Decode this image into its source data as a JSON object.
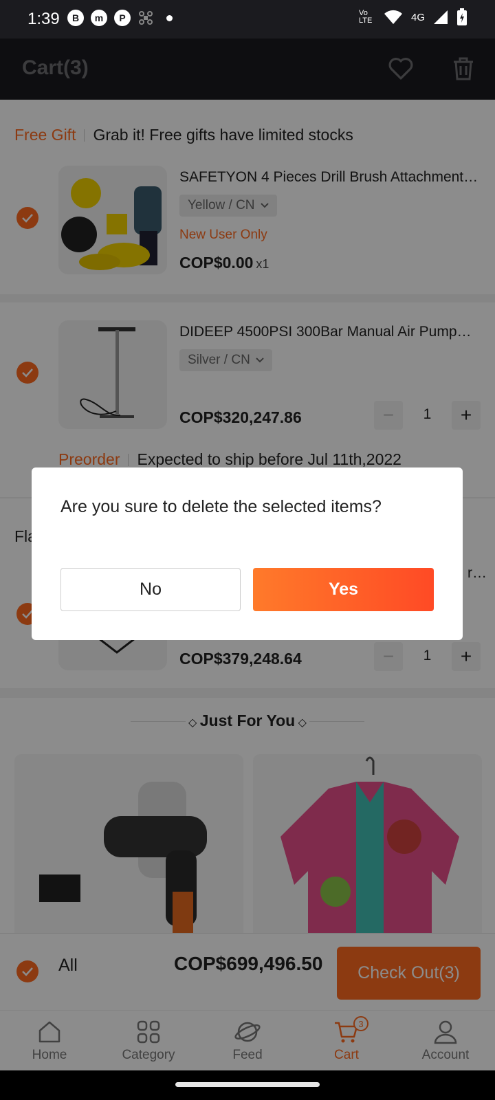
{
  "status_bar": {
    "time": "1:39",
    "notif_icons": [
      "B",
      "m",
      "P"
    ],
    "network": "4G",
    "volte": "Vo LTE"
  },
  "header": {
    "title": "Cart(3)"
  },
  "free_gift": {
    "tag": "Free Gift",
    "text": "Grab it! Free gifts have limited stocks"
  },
  "items": [
    {
      "name": "SAFETYON 4 Pieces Drill Brush Attachment…",
      "variant": "Yellow / CN",
      "note": "New User Only",
      "price": "COP$0.00",
      "qty_text": "x1"
    },
    {
      "name": "DIDEEP 4500PSI 300Bar Manual Air Pump…",
      "variant": "Silver / CN",
      "price": "COP$320,247.86",
      "qty": "1"
    },
    {
      "name": "r…",
      "price": "COP$379,248.64",
      "qty": "1"
    }
  ],
  "preorder": {
    "tag": "Preorder",
    "text": "Expected to ship before Jul 11th,2022"
  },
  "flash_partial": "Fla",
  "just_for_you": "Just For You",
  "checkout": {
    "all_label": "All",
    "total": "COP$699,496.50",
    "button": "Check Out(3)"
  },
  "tabs": [
    {
      "label": "Home",
      "icon": "home-icon"
    },
    {
      "label": "Category",
      "icon": "category-icon"
    },
    {
      "label": "Feed",
      "icon": "feed-icon"
    },
    {
      "label": "Cart",
      "icon": "cart-icon",
      "badge": "3",
      "active": true
    },
    {
      "label": "Account",
      "icon": "account-icon"
    }
  ],
  "dialog": {
    "message": "Are you sure to delete the selected items?",
    "no": "No",
    "yes": "Yes"
  },
  "colors": {
    "accent": "#ff6a20",
    "header_bg": "#1b1b1f"
  }
}
